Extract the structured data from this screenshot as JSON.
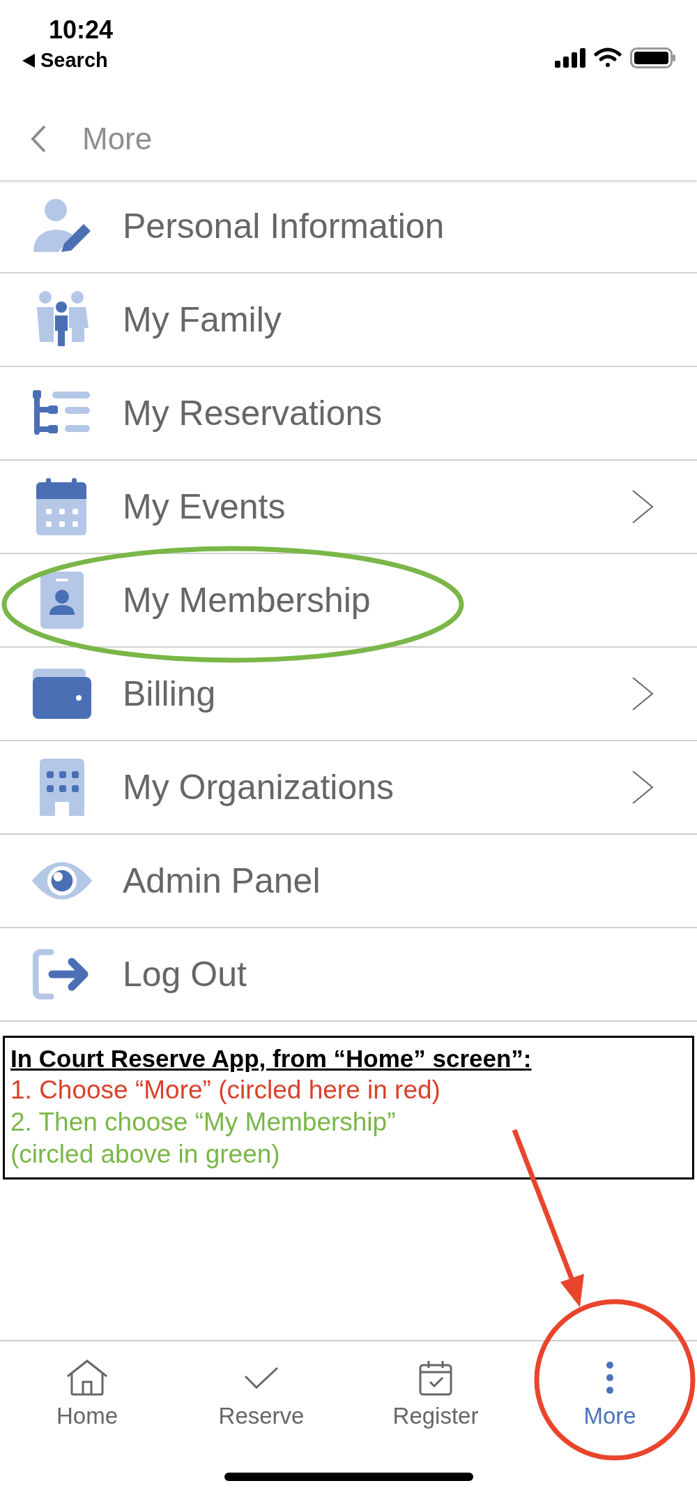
{
  "status_bar": {
    "time": "10:24",
    "back_label": "Search"
  },
  "nav": {
    "title": "More"
  },
  "menu": [
    {
      "label": "Personal Information",
      "chevron": false
    },
    {
      "label": "My Family",
      "chevron": false
    },
    {
      "label": "My Reservations",
      "chevron": false
    },
    {
      "label": "My Events",
      "chevron": true
    },
    {
      "label": "My Membership",
      "chevron": false
    },
    {
      "label": "Billing",
      "chevron": true
    },
    {
      "label": "My Organizations",
      "chevron": true
    },
    {
      "label": "Admin Panel",
      "chevron": false
    },
    {
      "label": "Log Out",
      "chevron": false
    }
  ],
  "instructions": {
    "title": "In Court Reserve App, from “Home” screen”:",
    "lines": [
      {
        "text": "1. Choose “More” (circled here in red)",
        "color": "#d9412a"
      },
      {
        "text": "2. Then choose “My Membership”",
        "color": "#7ab648"
      },
      {
        "text": "(circled above in green)",
        "color": "#7ab648"
      }
    ]
  },
  "tabs": [
    {
      "label": "Home",
      "selected": false
    },
    {
      "label": "Reserve",
      "selected": false
    },
    {
      "label": "Register",
      "selected": false
    },
    {
      "label": "More",
      "selected": true
    }
  ]
}
